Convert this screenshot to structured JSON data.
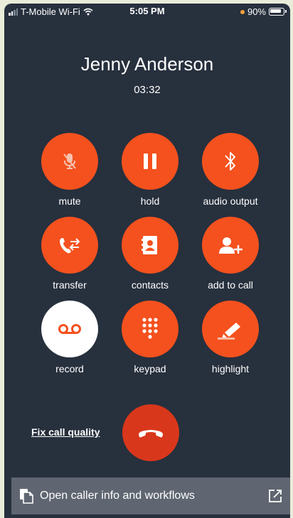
{
  "status_bar": {
    "carrier": "T-Mobile Wi-Fi",
    "time": "5:05 PM",
    "battery": "90%"
  },
  "call": {
    "caller_name": "Jenny Anderson",
    "duration": "03:32"
  },
  "controls": [
    {
      "label": "mute",
      "icon": "microphone-off-icon"
    },
    {
      "label": "hold",
      "icon": "pause-icon"
    },
    {
      "label": "audio output",
      "icon": "bluetooth-icon"
    },
    {
      "label": "transfer",
      "icon": "phone-transfer-icon"
    },
    {
      "label": "contacts",
      "icon": "contacts-book-icon"
    },
    {
      "label": "add to call",
      "icon": "add-person-icon"
    },
    {
      "label": "record",
      "icon": "voicemail-record-icon"
    },
    {
      "label": "keypad",
      "icon": "dialpad-icon"
    },
    {
      "label": "highlight",
      "icon": "highlighter-icon"
    }
  ],
  "footer": {
    "fix_call_quality": "Fix call quality",
    "open_caller_info": "Open caller info and workflows"
  },
  "colors": {
    "background": "#27303d",
    "accent": "#f4511e",
    "hangup": "#d9371b",
    "bottom_bar": "#5f6671"
  }
}
